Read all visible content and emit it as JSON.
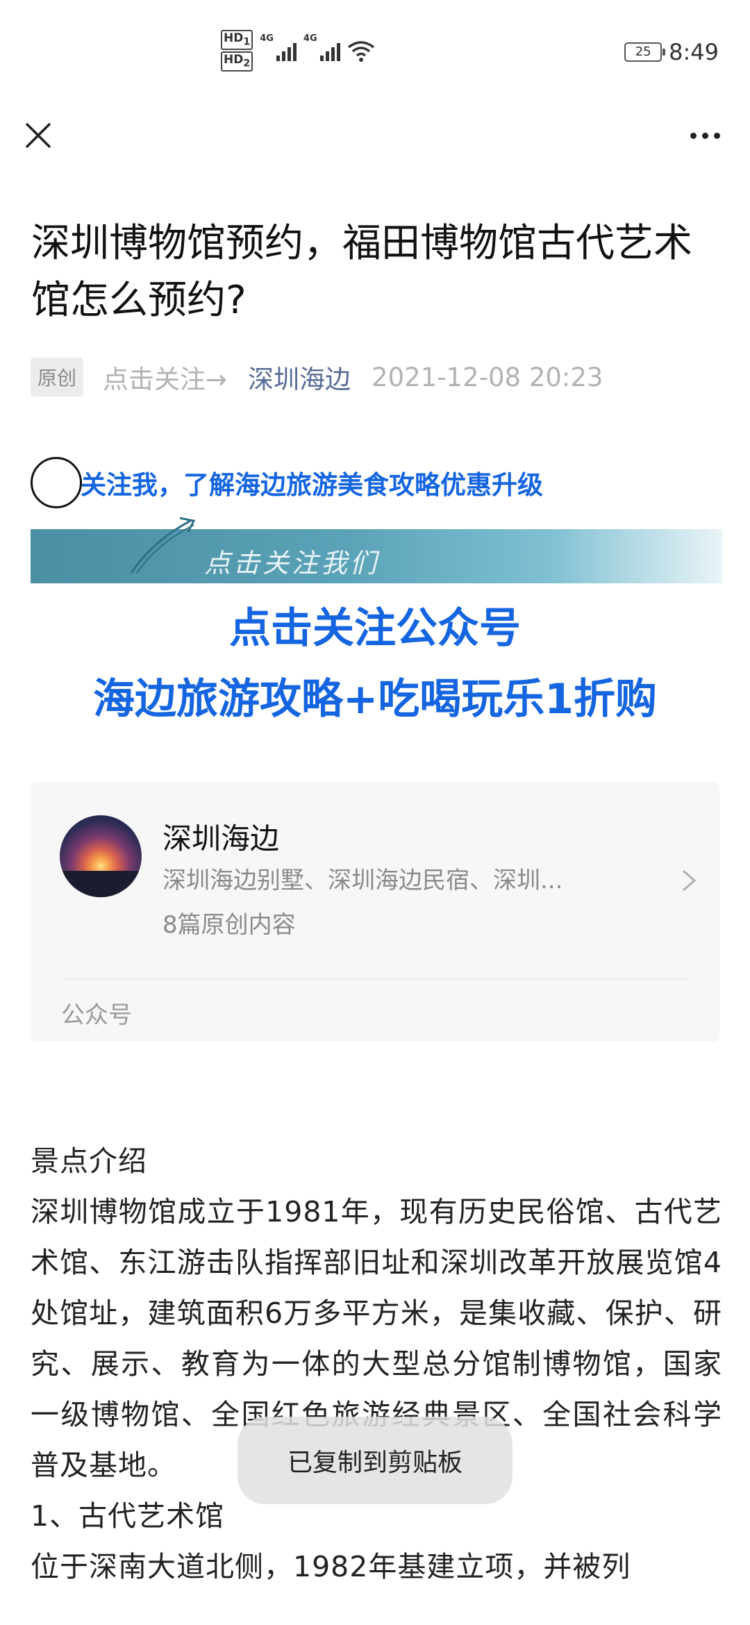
{
  "status_bar": {
    "hd1": "HD",
    "hd1_sub": "1",
    "hd2": "HD",
    "hd2_sub": "2",
    "net1": "4G",
    "net2": "4G",
    "battery": "25",
    "time": "8:49"
  },
  "nav": {
    "close_icon": "close-icon",
    "more_icon": "more-icon"
  },
  "article": {
    "title": "深圳博物馆预约，福田博物馆古代艺术馆怎么预约?",
    "tag": "原创",
    "follow_hint": "点击关注→",
    "author": "深圳海边",
    "date": "2021-12-08 20:23"
  },
  "promo": {
    "line": "关注我，了解海边旅游美食攻略优惠升级",
    "banner_text": "点击关注我们",
    "big_line1": "点击关注公众号",
    "big_line2": "海边旅游攻略+吃喝玩乐1折购"
  },
  "account_card": {
    "name": "深圳海边",
    "desc": "深圳海边别墅、深圳海边民宿、深圳...",
    "count": "8篇原创内容",
    "type": "公众号"
  },
  "body": {
    "heading": "景点介绍",
    "para1": "深圳博物馆成立于1981年，现有历史民俗馆、古代艺术馆、东江游击队指挥部旧址和深圳改革开放展览馆4处馆址，建筑面积6万多平方米，是集收藏、保护、研究、展示、教育为一体的大型总分馆制博物馆，国家一级博物馆、全国红色旅游经典景区、全国社会科学普及基地。",
    "sub1": "1、古代艺术馆",
    "para2": "位于深南大道北侧，1982年基建立项，并被列"
  },
  "toast": {
    "text": "已复制到剪贴板"
  },
  "colors": {
    "link_blue": "#576b95",
    "promo_blue": "#1565e0"
  }
}
